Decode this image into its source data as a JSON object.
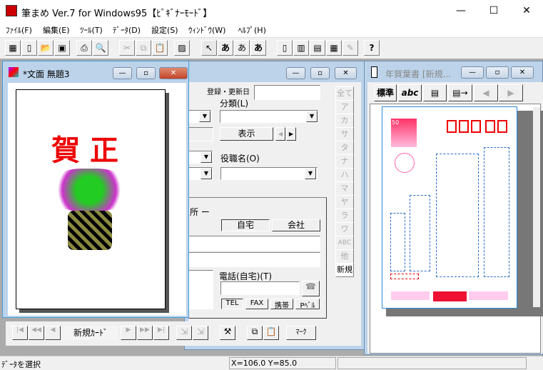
{
  "app": {
    "title": "筆まめ Ver.7 for Windows95【ﾋﾞｷﾞﾅｰﾓｰﾄﾞ】",
    "minimize": "—",
    "maximize": "☐",
    "close": "✕"
  },
  "menu": [
    "ﾌｧｲﾙ(F)",
    "編集(E)",
    "ﾂｰﾙ(T)",
    "ﾃﾞｰﾀ(D)",
    "設定(S)",
    "ｳｨﾝﾄﾞｳ(W)",
    "ﾍﾙﾌﾟ(H)"
  ],
  "toolbar": {
    "text_a": "あ",
    "text_b": "あ",
    "text_c": "あ",
    "help": "?"
  },
  "doc_window": {
    "title": "*文面  無題3",
    "text": "賀正"
  },
  "address_window": {
    "registered_label": "登録・更新日",
    "category_label": "分類(L)",
    "show_button": "表示",
    "title_label": "役職名(O)",
    "address_label": "所 ー",
    "home_tab": "自宅",
    "company_tab": "会社",
    "phone_label": "電話(自宅)(T)",
    "phone_types": [
      "TEL",
      "FAX",
      "携帯",
      "Pﾍﾞﾙ"
    ],
    "kana_tabs": [
      "全て",
      "ア",
      "カ",
      "サ",
      "タ",
      "ナ",
      "ハ",
      "マ",
      "ヤ",
      "ラ",
      "ワ",
      "ABC",
      "他",
      "新規"
    ],
    "nav_card": "新規ｶｰﾄﾞ",
    "mark_button": "ﾏｰｸ"
  },
  "nenga_window": {
    "title": "年賀葉書 [新規...",
    "standard_button": "標準",
    "abc_button": "abc",
    "stamp_value": "50"
  },
  "status": {
    "message": "ﾃﾞｰﾀを選択",
    "coords": "X=106.0 Y=85.0"
  }
}
